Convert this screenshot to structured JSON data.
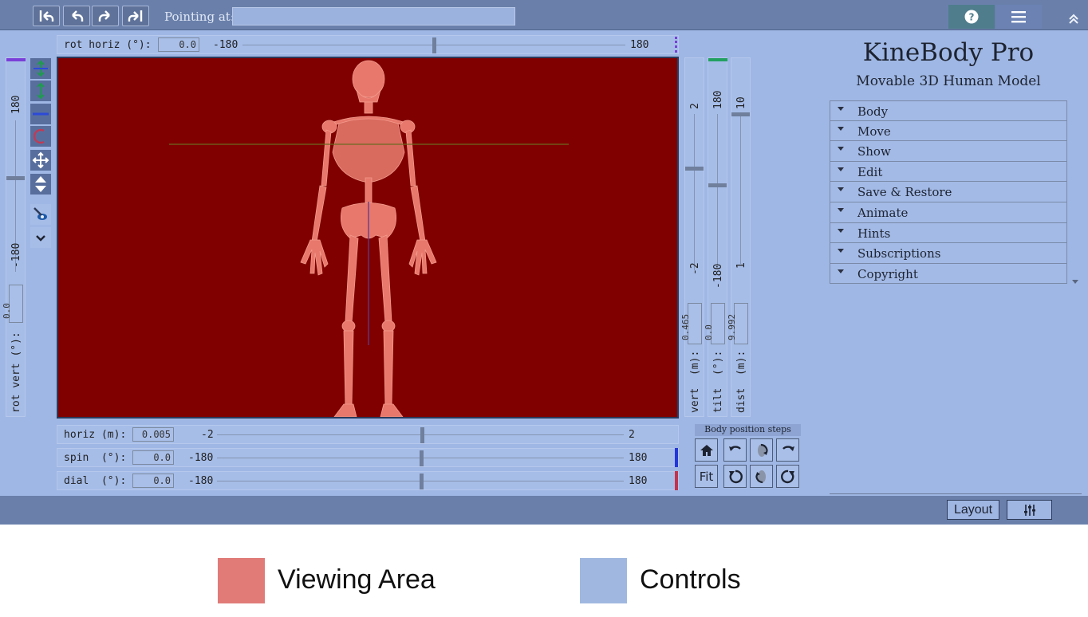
{
  "toolbar": {
    "buttons": [
      "undo-all-icon",
      "undo-icon",
      "redo-icon",
      "redo-all-icon"
    ],
    "pointing_label": "Pointing at:",
    "pointing_value": ""
  },
  "sliders": {
    "rot_horiz": {
      "label": "rot horiz (°):",
      "value": "0.0",
      "min": "-180",
      "max": "180",
      "position": 0.5
    },
    "rot_vert": {
      "label": "rot vert (°):",
      "value": "0.0",
      "min": "-180",
      "max": "180",
      "position": 0.5
    },
    "horiz": {
      "label": "horiz (m):",
      "value": "0.005",
      "min": "-2",
      "max": "2",
      "position": 0.5
    },
    "spin": {
      "label": "spin  (°):",
      "value": "0.0",
      "min": "-180",
      "max": "180",
      "position": 0.5
    },
    "dial": {
      "label": "dial  (°):",
      "value": "0.0",
      "min": "-180",
      "max": "180",
      "position": 0.5
    },
    "vert": {
      "label": "vert  (m):",
      "value": "0.465",
      "min": "-2",
      "max": "2",
      "position": 0.6
    },
    "tilt": {
      "label": "tilt  (°):",
      "value": "0.0",
      "min": "-180",
      "max": "180",
      "position": 0.5
    },
    "dist": {
      "label": "dist  (m):",
      "value": "9.992",
      "min": "1",
      "max": "10",
      "position": 0.99
    }
  },
  "panel": {
    "title": "KineBody Pro",
    "subtitle": "Movable 3D Human Model",
    "menu": [
      "Body",
      "Move",
      "Show",
      "Edit",
      "Save & Restore",
      "Animate",
      "Hints",
      "Subscriptions",
      "Copyright"
    ]
  },
  "steps": {
    "title": "Body position steps",
    "fit_label": "Fit"
  },
  "bottom": {
    "layout_label": "Layout"
  },
  "legend": {
    "viewing_area": "Viewing Area",
    "controls": "Controls",
    "viewing_color": "#e07b78",
    "controls_color": "#a0b8e0"
  },
  "colors": {
    "viewport_bg": "#800000",
    "controls_bg": "#9fb7e4",
    "skeleton": "#e8786c"
  }
}
